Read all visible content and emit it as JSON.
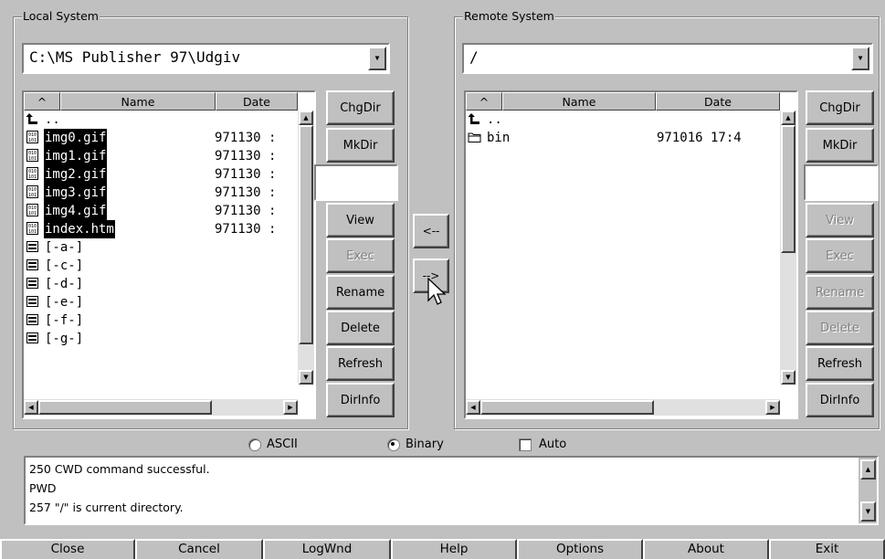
{
  "local": {
    "title": "Local System",
    "path": "C:\\MS Publisher 97\\Udgiv",
    "col_sort": "^",
    "col_name": "Name",
    "col_date": "Date",
    "files": [
      {
        "name": "..",
        "date": "",
        "icon": "up-folder-icon",
        "selected": false
      },
      {
        "name": "img0.gif",
        "date": "971130 :",
        "icon": "binary-file-icon",
        "selected": true
      },
      {
        "name": "img1.gif",
        "date": "971130 :",
        "icon": "binary-file-icon",
        "selected": true
      },
      {
        "name": "img2.gif",
        "date": "971130 :",
        "icon": "binary-file-icon",
        "selected": true
      },
      {
        "name": "img3.gif",
        "date": "971130 :",
        "icon": "binary-file-icon",
        "selected": true
      },
      {
        "name": "img4.gif",
        "date": "971130 :",
        "icon": "binary-file-icon",
        "selected": true
      },
      {
        "name": "index.htm",
        "date": "971130 :",
        "icon": "binary-file-icon",
        "selected": true
      },
      {
        "name": "[-a-]",
        "date": "",
        "icon": "drive-icon",
        "selected": false
      },
      {
        "name": "[-c-]",
        "date": "",
        "icon": "drive-icon",
        "selected": false
      },
      {
        "name": "[-d-]",
        "date": "",
        "icon": "drive-icon",
        "selected": false
      },
      {
        "name": "[-e-]",
        "date": "",
        "icon": "drive-icon",
        "selected": false
      },
      {
        "name": "[-f-]",
        "date": "",
        "icon": "drive-icon",
        "selected": false
      },
      {
        "name": "[-g-]",
        "date": "",
        "icon": "drive-icon",
        "selected": false
      }
    ],
    "buttons": {
      "chgdir": "ChgDir",
      "mkdir": "MkDir",
      "view": "View",
      "exec": "Exec",
      "rename": "Rename",
      "delete": "Delete",
      "refresh": "Refresh",
      "dirinfo": "DirInfo"
    }
  },
  "remote": {
    "title": "Remote System",
    "path": "/",
    "col_sort": "^",
    "col_name": "Name",
    "col_date": "Date",
    "files": [
      {
        "name": "..",
        "date": "",
        "icon": "up-folder-icon"
      },
      {
        "name": "bin",
        "date": "971016 17:4",
        "icon": "folder-icon"
      }
    ],
    "buttons": {
      "chgdir": "ChgDir",
      "mkdir": "MkDir",
      "view": "View",
      "exec": "Exec",
      "rename": "Rename",
      "delete": "Delete",
      "refresh": "Refresh",
      "dirinfo": "DirInfo"
    }
  },
  "transfer": {
    "download": "<--",
    "upload": "-->"
  },
  "mode": {
    "ascii": "ASCII",
    "binary": "Binary",
    "auto": "Auto",
    "selected": "binary"
  },
  "log": [
    "250 CWD command successful.",
    "PWD",
    "257 \"/\" is current directory."
  ],
  "bottom": {
    "close": "Close",
    "cancel": "Cancel",
    "logwnd": "LogWnd",
    "help": "Help",
    "options": "Options",
    "about": "About",
    "exit": "Exit"
  }
}
